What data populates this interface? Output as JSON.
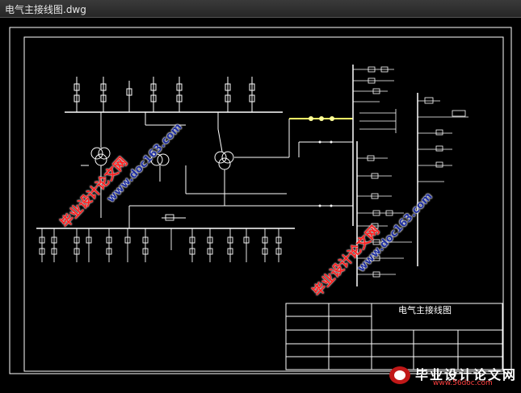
{
  "window": {
    "title": "电气主接线图.dwg"
  },
  "drawing": {
    "title_block_title": "电气主接线图"
  },
  "watermarks": {
    "line1": "毕业设计论文网",
    "line2": "www.doc163.com"
  },
  "brand": {
    "name": "毕业设计论文网",
    "url": "www.56doc.com"
  },
  "colors": {
    "background": "#000000",
    "lines": "#ffffff",
    "highlight_bus": "#ffff66",
    "watermark_red": "#ff2020"
  }
}
